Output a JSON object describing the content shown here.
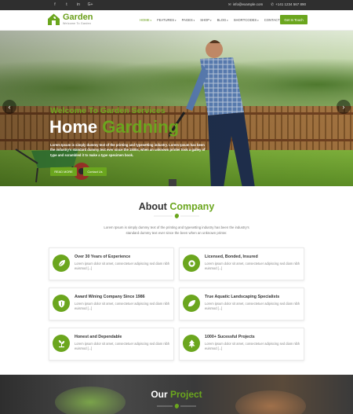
{
  "topbar": {
    "social": [
      "f",
      "t",
      "in",
      "G+"
    ],
    "email": "info@example.com",
    "phone": "+141 1234 567 890"
  },
  "header": {
    "logo_title": "Garden",
    "logo_tagline": "Welcome To Garden",
    "nav": [
      "HOME",
      "FEATURES",
      "PAGES",
      "SHOP",
      "BLOG",
      "SHORTCODES",
      "CONTACT US"
    ],
    "cta_label": "Get In Touch"
  },
  "hero": {
    "kicker": "Welcome To Garden Services",
    "title_white": "Home ",
    "title_green": "Gardning",
    "description": "Lorem Ipsum is simply dummy text of the printing and typesetting industry. Lorem Ipsum has been the industry's standard dummy text ever since the 1500s, when an unknown printer took a galley of type and scrambled it to make a type specimen book.",
    "read_more": "READ MORE",
    "contact_us": "Contact Us",
    "prev_arrow": "‹",
    "next_arrow": "›"
  },
  "about": {
    "title_dark": "About ",
    "title_green": "Company",
    "intro": "Lorem Ipsum is simply dummy text of the printing and typesetting industry has been the industry's standard dummy text ever since the been when an unknown printer.",
    "cards": [
      {
        "title": "Over 30 Years of Experience",
        "text": "Lorem ipsum dolor sit amet, consectetuer adipiscing sed diam nibh euismod [...]",
        "icon": "leaf-icon"
      },
      {
        "title": "Licensed, Bonded, Insured",
        "text": "Lorem ipsum dolor sit amet, consectetuer adipiscing sed diam nibh euismod [...]",
        "icon": "seal-icon"
      },
      {
        "title": "Award Wining Company Since 1986",
        "text": "Lorem ipsum dolor sit amet, consectetuer adipiscing sed diam nibh euismod [...]",
        "icon": "shield-icon"
      },
      {
        "title": "True Aquatic Landscaping Specialists",
        "text": "Lorem ipsum dolor sit amet, consectetuer adipiscing sed diam nibh euismod [...]",
        "icon": "leaf-icon"
      },
      {
        "title": "Honest and Dependable",
        "text": "Lorem ipsum dolor sit amet, consectetuer adipiscing sed diam nibh euismod [...]",
        "icon": "plant-icon"
      },
      {
        "title": "1000+ Sucessful Projects",
        "text": "Lorem ipsum dolor sit amet, consectetuer adipiscing sed diam nibh euismod [...]",
        "icon": "tree-icon"
      }
    ]
  },
  "project": {
    "title_white": "Our ",
    "title_green": "Project"
  },
  "colors": {
    "accent": "#6ba61e",
    "topbar": "#2f2f2f"
  }
}
